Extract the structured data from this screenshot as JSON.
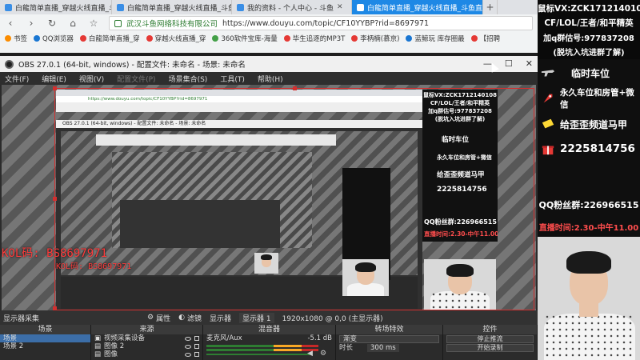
{
  "browser": {
    "tabs": [
      {
        "label": "白龍简单直播_穿越火线直播_斗鱼直",
        "active": false
      },
      {
        "label": "白龍简单直播_穿越火线直播_斗鱼直",
        "active": false
      },
      {
        "label": "我的资料 - 个人中心 - 斗鱼",
        "active": false
      },
      {
        "label": "白龍简单直播_穿越火线直播_斗鱼直",
        "active": true
      }
    ],
    "new_tab": "+",
    "url_site": "武汉斗鱼网络科技有限公司",
    "url": "https://www.douyu.com/topic/CF10YYBP?rid=8697971",
    "bookmarks": [
      {
        "label": "书签",
        "color": "#fb8c00"
      },
      {
        "label": "QQ浏览器",
        "color": "#1976d2"
      },
      {
        "label": "白龍简单直播_穿",
        "color": "#e53935"
      },
      {
        "label": "穿越火线直播_穿",
        "color": "#e53935"
      },
      {
        "label": "360软件宝库-海量",
        "color": "#43a047"
      },
      {
        "label": "毕生追逐的MP3T",
        "color": "#e53935"
      },
      {
        "label": "李柄楠(慕京)",
        "color": "#e53935"
      },
      {
        "label": "蓝鲸玩 库存圈最",
        "color": "#1976d2"
      },
      {
        "label": "【招聘",
        "color": "#e53935"
      }
    ]
  },
  "obs": {
    "title": "OBS 27.0.1 (64-bit, windows) - 配置文件: 未命名 - 场景: 未命名",
    "menu": [
      "文件(F)",
      "编辑(E)",
      "视图(V)",
      "配置文件(P)",
      "场景集合(S)",
      "工具(T)",
      "帮助(H)"
    ],
    "preview_overlay_text": "KOL码: BS8697971",
    "preview_overlay_text_small": "KOL码: BS8697971",
    "source_label": "显示器采集",
    "source_buttons": [
      "属性",
      "滤镜",
      "显示器",
      "显示器 1",
      "1920x1080 @ 0,0 (主显示器)"
    ],
    "docks": {
      "scenes": {
        "title": "场景",
        "items": [
          "场景",
          "场景 2"
        ]
      },
      "sources": {
        "title": "来源",
        "items": [
          "视频采集设备",
          "图像 2",
          "图像"
        ]
      },
      "mixer": {
        "title": "混音器",
        "channel": "麦克风/Aux",
        "db": "-5.1 dB"
      },
      "transitions": {
        "title": "转场特效",
        "type": "渐变",
        "duration_label": "时长",
        "duration": "300 ms"
      },
      "controls": {
        "title": "控件",
        "buttons": [
          "停止推流",
          "开始录制"
        ]
      }
    }
  },
  "overlay": {
    "line1": "鼠标VX:ZCK1712140108",
    "line2": "CF/LOL/王者/和平精英",
    "line3": "加q群估号:977837208",
    "line4": "(脱坑入坑进群了解)",
    "items": [
      {
        "icon": "gun-icon",
        "label": "临时车位"
      },
      {
        "icon": "rocket-icon",
        "label": "永久车位和房管+微信"
      },
      {
        "icon": "ticket-icon",
        "label": "给歪歪频道马甲"
      },
      {
        "icon": "gift-icon",
        "label": "2225814756"
      }
    ],
    "qq_group": "QQ粉丝群:226966515",
    "live_time": "直播时间:2.30-中午11.00"
  }
}
